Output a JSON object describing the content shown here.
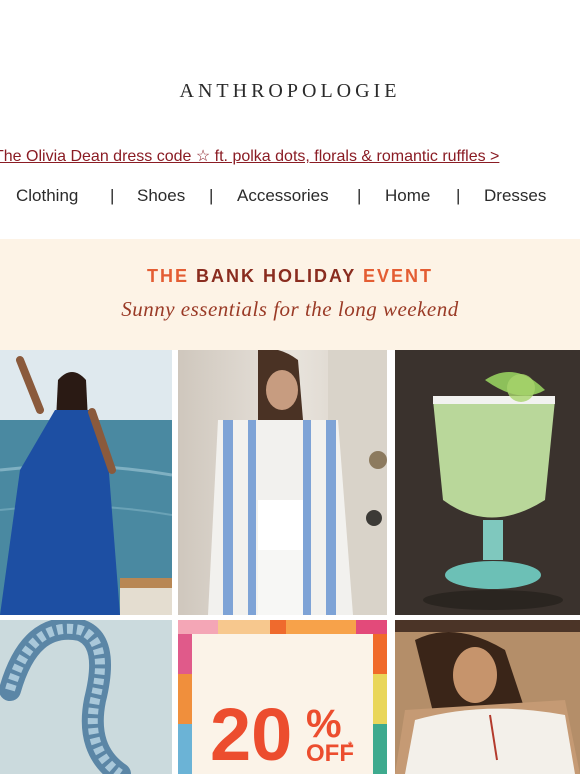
{
  "brand": {
    "logo_text": "ANTHROPOLOGIE"
  },
  "promo": {
    "text": "The Olivia Dean dress code ☆ ft. polka dots, florals & romantic ruffles >"
  },
  "nav": {
    "items": [
      "Clothing",
      "Shoes",
      "Accessories",
      "Home",
      "Dresses"
    ],
    "separator": "|"
  },
  "banner": {
    "title_part1": "THE",
    "title_part2": "BANK HOLIDAY",
    "title_part3": "EVENT",
    "subtitle": "Sunny essentials for the long weekend"
  },
  "offer": {
    "percent": "20",
    "percent_sign": "%",
    "off": "OFF",
    "asterisk": "*"
  },
  "colors": {
    "accent_red": "#8a1c24",
    "banner_bg": "#fdf3e6",
    "orange": "#e45d33"
  },
  "tiles": [
    "woman-in-blue-dress-photo",
    "striped-shirt-photo",
    "margarita-glass-photo",
    "blue-strap-photo",
    "20-percent-off-graphic",
    "woman-in-white-top-photo"
  ]
}
